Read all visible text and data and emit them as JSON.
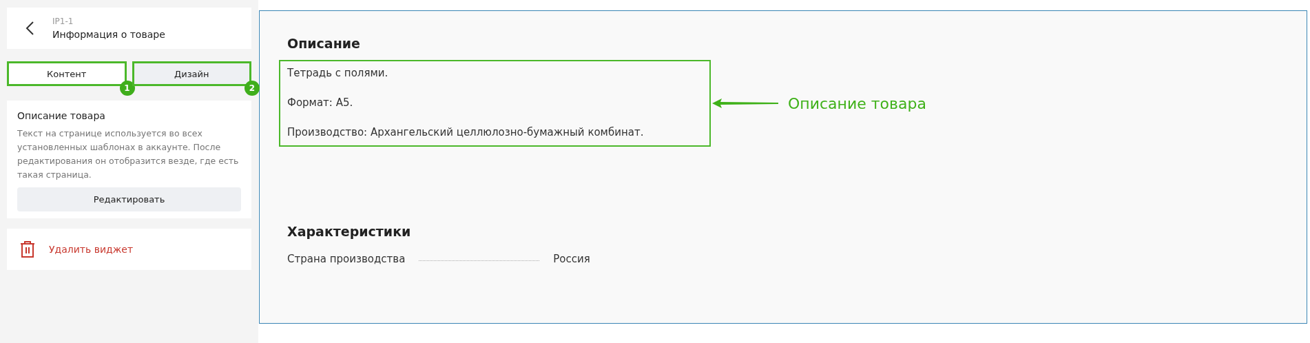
{
  "header": {
    "code": "IP1-1",
    "title": "Информация о товаре"
  },
  "tabs": [
    {
      "label": "Контент",
      "selected": true,
      "badge": "1"
    },
    {
      "label": "Дизайн",
      "selected": false,
      "badge": "2"
    }
  ],
  "description_card": {
    "title": "Описание товара",
    "text": "Текст на странице используется во всех установленных шаблонах в аккаунте. После редактирования он отобразится везде, где есть такая страница.",
    "button": "Редактировать"
  },
  "delete_button": "Удалить виджет",
  "preview": {
    "description_title": "Описание",
    "description_lines": [
      "Тетрадь с полями.",
      "Формат: А5.",
      "Производство: Архангельский целлюлозно-бумажный комбинат."
    ],
    "annotation": "Описание товара",
    "characteristics_title": "Характеристики",
    "characteristics": [
      {
        "name": "Страна производства",
        "value": "Россия"
      }
    ]
  }
}
